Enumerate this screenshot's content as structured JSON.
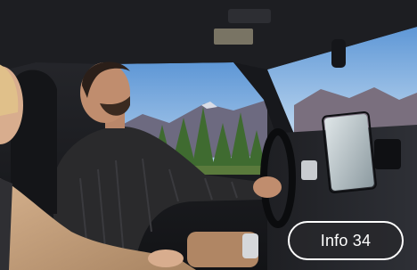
{
  "photo": {
    "subject": "driver-and-passenger-in-truck-cabin",
    "accent_colors": {
      "sky": "#7fb0e0",
      "mountains": "#6d6a80",
      "trees": "#4f7a3a",
      "sweater": "#2a2a2c",
      "cabin_dark": "#1c1d21",
      "passenger_coat": "#c8a27e"
    }
  },
  "badge": {
    "label": "Info 34",
    "border_color": "#ffffff",
    "background": "#333337"
  }
}
